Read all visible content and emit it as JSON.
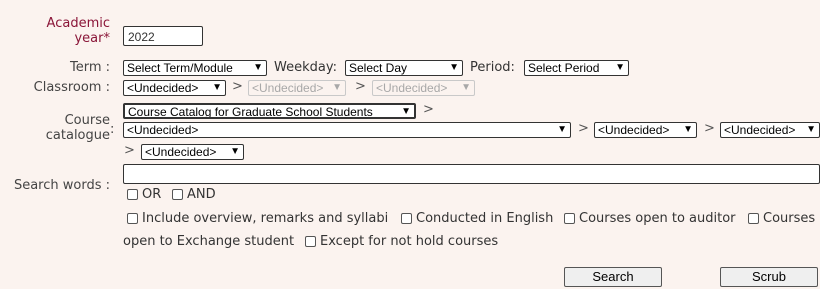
{
  "labels": {
    "academic_year_line1": "Academic",
    "academic_year_line2": "year*",
    "term": "Term",
    "classroom": "Classroom",
    "course_catalogue_line1": "Course",
    "course_catalogue_line2": "catalogue",
    "search_words": "Search words",
    "weekday": "Weekday:",
    "period": "Period:",
    "colon": ":"
  },
  "fields": {
    "academic_year_value": "2022",
    "term": "Select Term/Module",
    "weekday": "Select Day",
    "period": "Select Period",
    "classroom_1": "<Undecided>",
    "classroom_2": "<Undecided>",
    "classroom_3": "<Undecided>",
    "catalog_main": "Course Catalog for Graduate School Students",
    "catalog_1": "<Undecided>",
    "catalog_2": "<Undecided>",
    "catalog_3": "<Undecided>",
    "catalog_4": "<Undecided>",
    "search_words": ""
  },
  "separators": {
    "gt": ">"
  },
  "checkboxes": {
    "or": "OR",
    "and": "AND",
    "include_overview": "Include overview, remarks and syllabi",
    "conducted_english": "Conducted in English",
    "open_auditor": "Courses open to auditor",
    "open_exchange_a": "Courses",
    "open_exchange_b": "open to Exchange student",
    "except_not_hold": "Except for not hold courses"
  },
  "buttons": {
    "search": "Search",
    "scrub": "Scrub"
  }
}
